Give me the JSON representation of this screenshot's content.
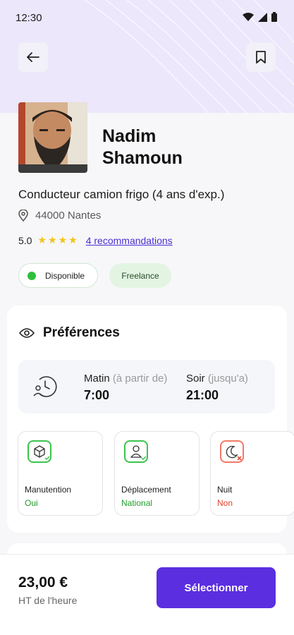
{
  "status_bar": {
    "time": "12:30"
  },
  "profile": {
    "first_name": "Nadim",
    "last_name": "Shamoun",
    "job": "Conducteur camion frigo (4 ans d'exp.)",
    "location": "44000 Nantes",
    "rating": "5.0",
    "stars": 4,
    "recommendations": "4 recommandations"
  },
  "chips": {
    "availability": "Disponible",
    "contract": "Freelance"
  },
  "preferences": {
    "title": "Préférences",
    "matin_label": "Matin",
    "matin_hint": "(à partir de)",
    "matin_value": "7:00",
    "soir_label": "Soir",
    "soir_hint": "(jusqu'a)",
    "soir_value": "21:00",
    "items": [
      {
        "label": "Manutention",
        "value": "Oui",
        "status": "ok"
      },
      {
        "label": "Déplacement",
        "value": "National",
        "status": "ok"
      },
      {
        "label": "Nuit",
        "value": "Non",
        "status": "no"
      }
    ]
  },
  "footer": {
    "price": "23,00 €",
    "unit": "HT de l'heure",
    "cta": "Sélectionner"
  },
  "colors": {
    "accent": "#5b2ee0",
    "hero": "#ece7fb",
    "available": "#2fbf3a"
  }
}
